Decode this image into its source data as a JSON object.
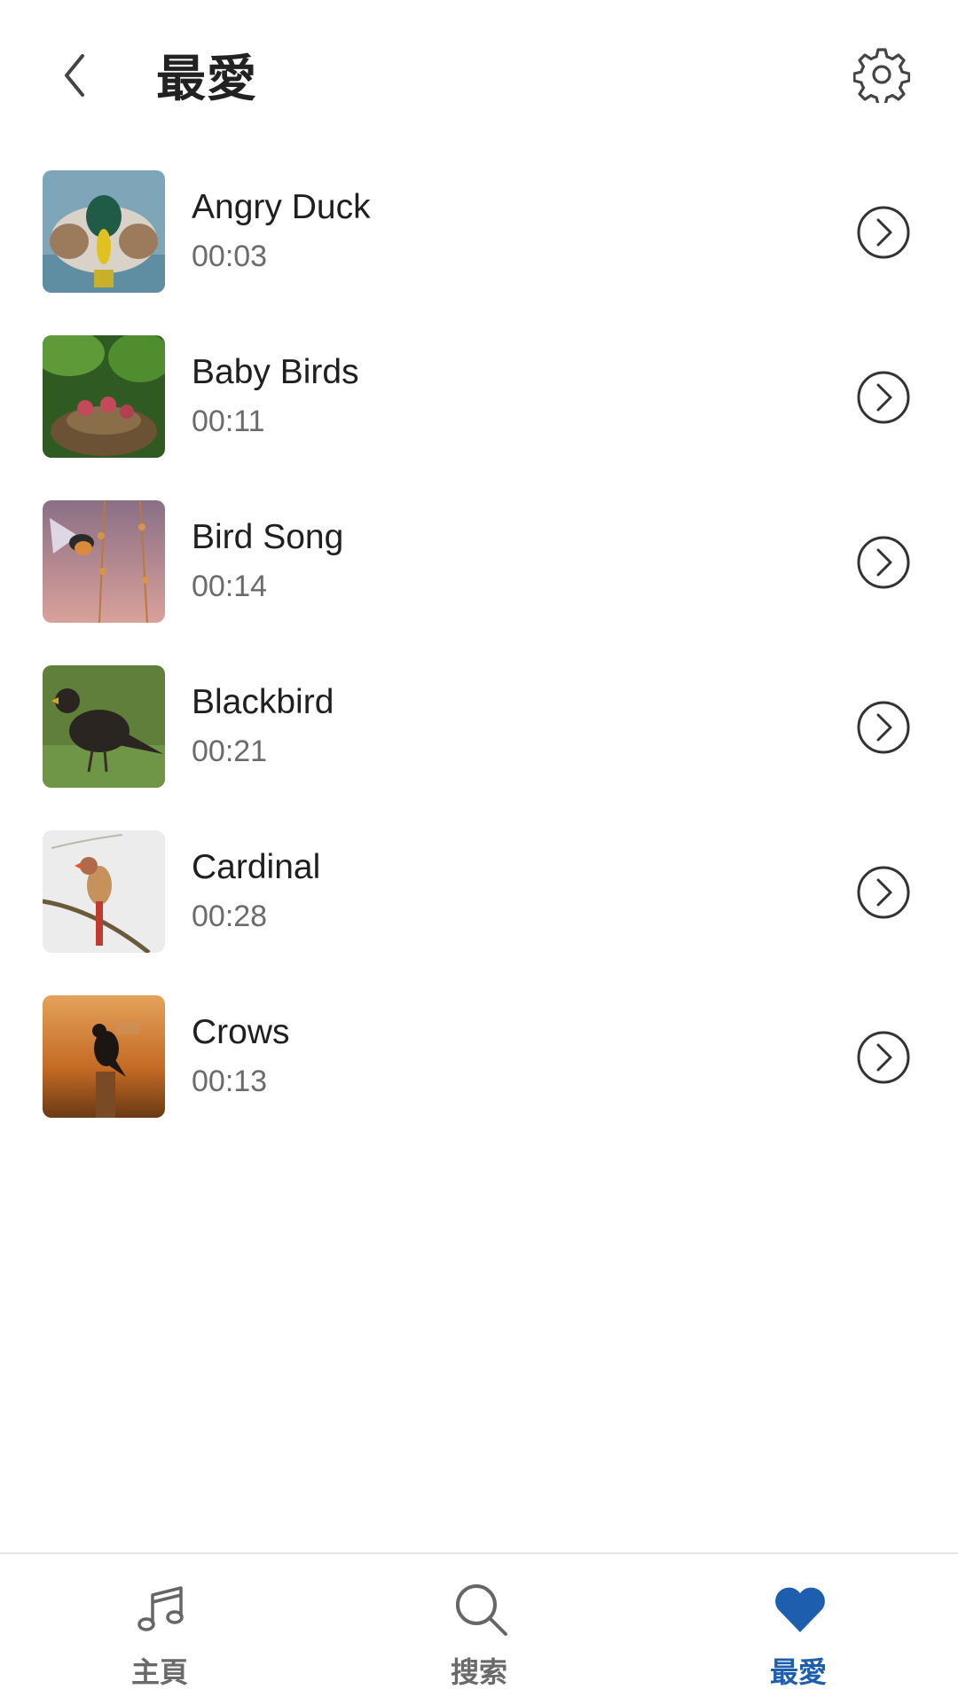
{
  "header": {
    "title": "最愛",
    "back_icon": "chevron-left-icon",
    "settings_icon": "gear-icon"
  },
  "favorites": [
    {
      "name": "Angry Duck",
      "duration": "00:03",
      "thumbnail": "mallard-duck"
    },
    {
      "name": "Baby Birds",
      "duration": "00:11",
      "thumbnail": "baby-birds-nest"
    },
    {
      "name": "Bird Song",
      "duration": "00:14",
      "thumbnail": "songbird-flying"
    },
    {
      "name": "Blackbird",
      "duration": "00:21",
      "thumbnail": "blackbird-grass"
    },
    {
      "name": "Cardinal",
      "duration": "00:28",
      "thumbnail": "cardinal-branch"
    },
    {
      "name": "Crows",
      "duration": "00:13",
      "thumbnail": "crow-post"
    }
  ],
  "tabs": [
    {
      "label": "主頁",
      "icon": "music-note-icon",
      "active": false
    },
    {
      "label": "搜索",
      "icon": "search-icon",
      "active": false
    },
    {
      "label": "最愛",
      "icon": "heart-icon",
      "active": true
    }
  ],
  "colors": {
    "accent": "#1d5fae",
    "text": "#222222",
    "secondary_text": "#6b6b6b",
    "inactive_tab": "#6a6a6a"
  }
}
